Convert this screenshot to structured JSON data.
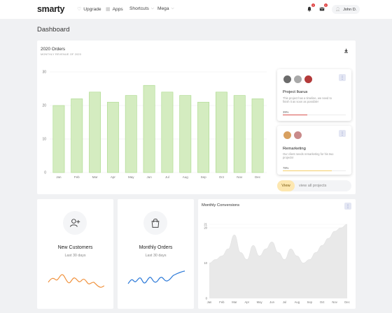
{
  "header": {
    "logo": "smarty",
    "nav": [
      {
        "label": "Upgrade",
        "icon": "heart-icon"
      },
      {
        "label": "Apps",
        "icon": "grid-icon"
      },
      {
        "label": "Shortcuts",
        "icon": "chevron-down-icon"
      },
      {
        "label": "Mega",
        "icon": "chevron-down-icon"
      }
    ],
    "notification_count": "1",
    "message_count": "1",
    "user_name": "John D."
  },
  "page_title": "Dashboard",
  "orders": {
    "title": "2020 Orders",
    "subtitle": "MONTHLY REVENUE OF 2020",
    "download_icon": "download-icon"
  },
  "projects": [
    {
      "name": "Project Ikarus",
      "description_lines": [
        "This project has a timeline, we need to",
        "finish it as soon as possible!"
      ],
      "percent_label": "39%",
      "progress": 0.39,
      "bar_color": "#d9534f",
      "avatars": [
        "#6b6b6b",
        "#a9a9a9",
        "#b33a3a"
      ]
    },
    {
      "name": "Remarketing",
      "description_lines": [
        "Our client needs remarketing for his two",
        "projects!"
      ],
      "percent_label": "78%",
      "progress": 0.78,
      "bar_color": "#f5cf6a",
      "avatars": [
        "#d8a060",
        "#c98a8a"
      ]
    }
  ],
  "view_button": "View",
  "view_all": "view all projects",
  "new_customers": {
    "title": "New Customers",
    "subtitle": "Last 30 days",
    "icon": "add-user-icon",
    "color": "#f0903a"
  },
  "monthly_orders": {
    "title": "Monthly Orders",
    "subtitle": "Last 30 days",
    "icon": "shopping-bag-icon",
    "color": "#2a78d8"
  },
  "conversions": {
    "title": "Monthly Conversions"
  },
  "chart_data": [
    {
      "type": "bar",
      "title": "2020 Orders",
      "subtitle": "MONTHLY REVENUE OF 2020",
      "categories": [
        "Jan",
        "Feb",
        "Mar",
        "Apr",
        "May",
        "Jun",
        "Jul",
        "Aug",
        "Sep",
        "Oct",
        "Nov",
        "Dec"
      ],
      "values": [
        20,
        22,
        24,
        21,
        23,
        26,
        24,
        23,
        21,
        24,
        23,
        22
      ],
      "ylim": [
        0,
        30
      ],
      "yticks": [
        0,
        10,
        20,
        30
      ],
      "color": "#d4ecc0",
      "border_color": "#a9d98a",
      "grid": true
    },
    {
      "type": "area",
      "title": "Monthly Conversions",
      "categories": [
        "Jan",
        "Feb",
        "Mar",
        "Apr",
        "May",
        "Jun",
        "Jul",
        "Aug",
        "Sep",
        "Oct",
        "Nov",
        "Dec"
      ],
      "x": [
        0,
        0.5,
        1,
        1.5,
        2,
        2.5,
        3,
        3.5,
        4,
        4.5,
        5,
        5.5,
        6,
        6.5,
        7,
        7.5,
        8,
        8.5,
        9,
        9.5,
        10,
        10.5,
        11
      ],
      "values": [
        10,
        11,
        12,
        14,
        18,
        13,
        11,
        15,
        12,
        14,
        16,
        13,
        11,
        14,
        12,
        10,
        11,
        13,
        15,
        17,
        19,
        20,
        21
      ],
      "ylim": [
        0,
        21
      ],
      "yticks": [
        0,
        10,
        20,
        21
      ],
      "color": "#e9e9e9",
      "grid": true
    }
  ]
}
